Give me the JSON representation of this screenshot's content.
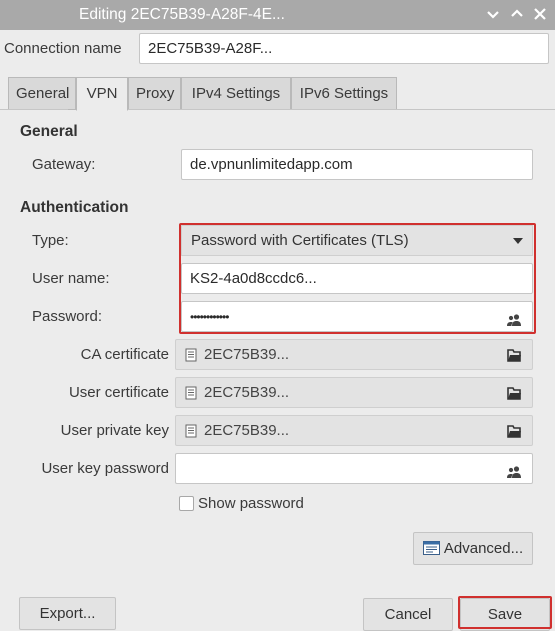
{
  "window": {
    "title": "Editing 2EC75B39-A28F-4E..."
  },
  "connection": {
    "label": "Connection name",
    "value": "2EC75B39-A28F..."
  },
  "tabs": [
    {
      "label": "General"
    },
    {
      "label": "VPN"
    },
    {
      "label": "Proxy"
    },
    {
      "label": "IPv4 Settings"
    },
    {
      "label": "IPv6 Settings"
    }
  ],
  "general": {
    "heading": "General",
    "gateway_label": "Gateway:",
    "gateway_value": "de.vpnunlimitedapp.com"
  },
  "auth": {
    "heading": "Authentication",
    "type_label": "Type:",
    "type_value": "Password with Certificates (TLS)",
    "username_label": "User name:",
    "username_value": "KS2-4a0d8ccdc6...",
    "password_label": "Password:",
    "password_value": "••••••••••••",
    "ca_label": "CA certificate",
    "ca_value": "2EC75B39...",
    "usercert_label": "User certificate",
    "usercert_value": "2EC75B39...",
    "privkey_label": "User private key",
    "privkey_value": "2EC75B39...",
    "keypass_label": "User key password",
    "keypass_value": "",
    "show_password_label": "Show password"
  },
  "buttons": {
    "advanced": "Advanced...",
    "export": "Export...",
    "cancel": "Cancel",
    "save": "Save"
  },
  "colors": {
    "highlight": "#d0302e"
  }
}
